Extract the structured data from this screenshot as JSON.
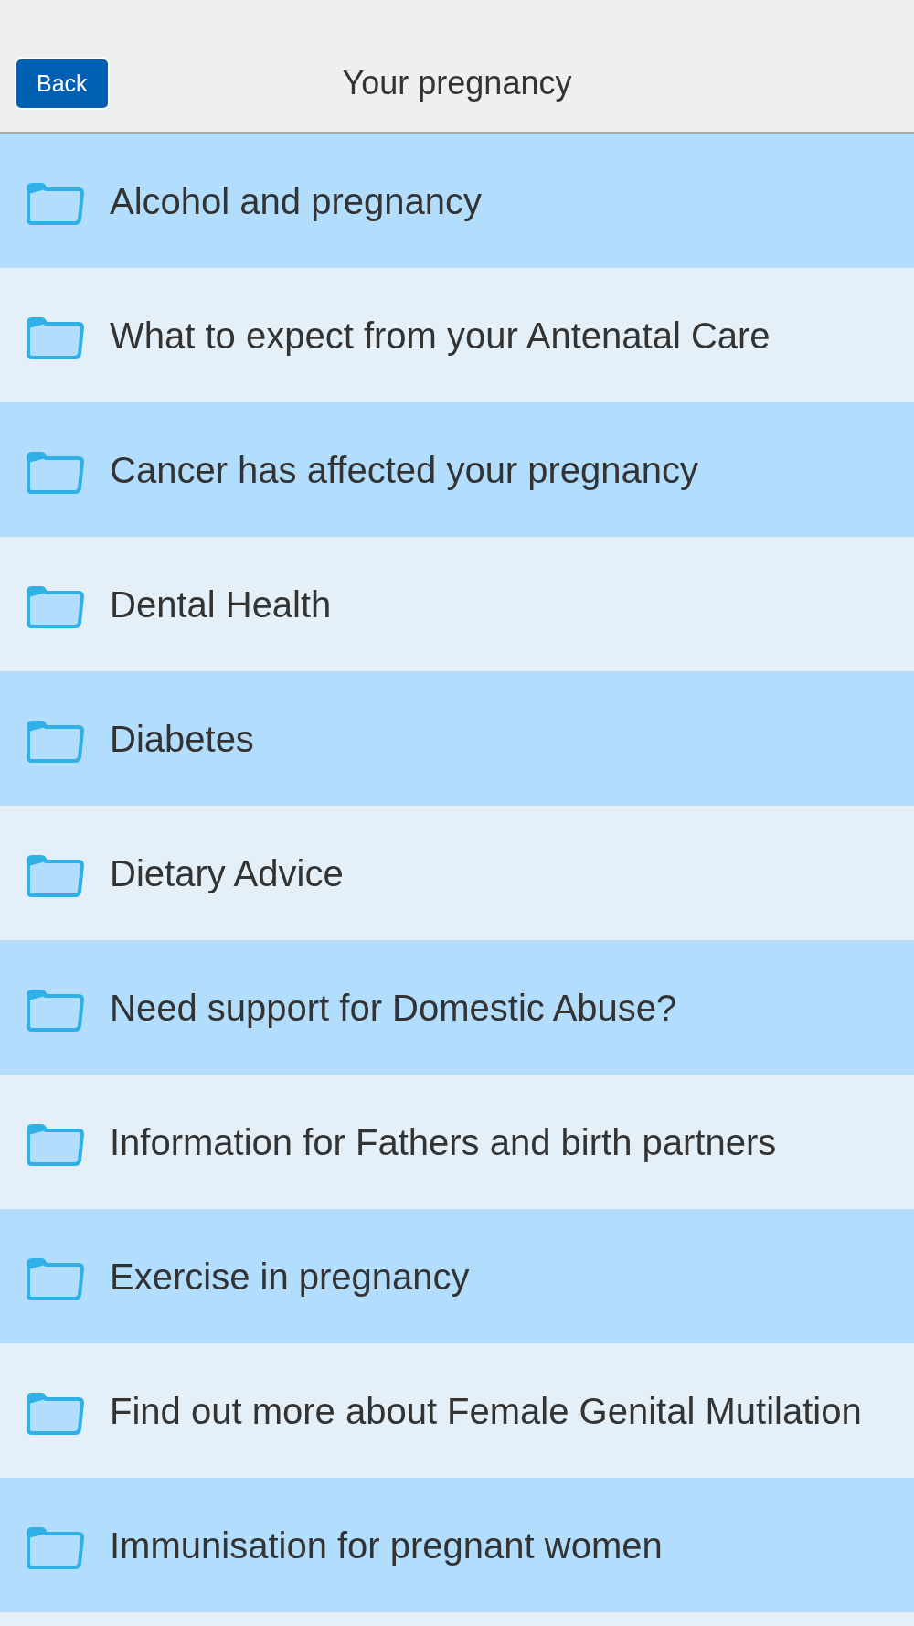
{
  "header": {
    "back_button": "Back",
    "title": "Your pregnancy"
  },
  "items": [
    {
      "label": "Alcohol and pregnancy"
    },
    {
      "label": "What to expect from your Antenatal Care"
    },
    {
      "label": "Cancer has affected your pregnancy"
    },
    {
      "label": "Dental Health"
    },
    {
      "label": "Diabetes"
    },
    {
      "label": "Dietary Advice"
    },
    {
      "label": "Need support for Domestic Abuse?"
    },
    {
      "label": "Information for Fathers and birth partners"
    },
    {
      "label": "Exercise in pregnancy"
    },
    {
      "label": "Find out more about Female Genital Mutilation"
    },
    {
      "label": "Immunisation for pregnant women"
    }
  ]
}
